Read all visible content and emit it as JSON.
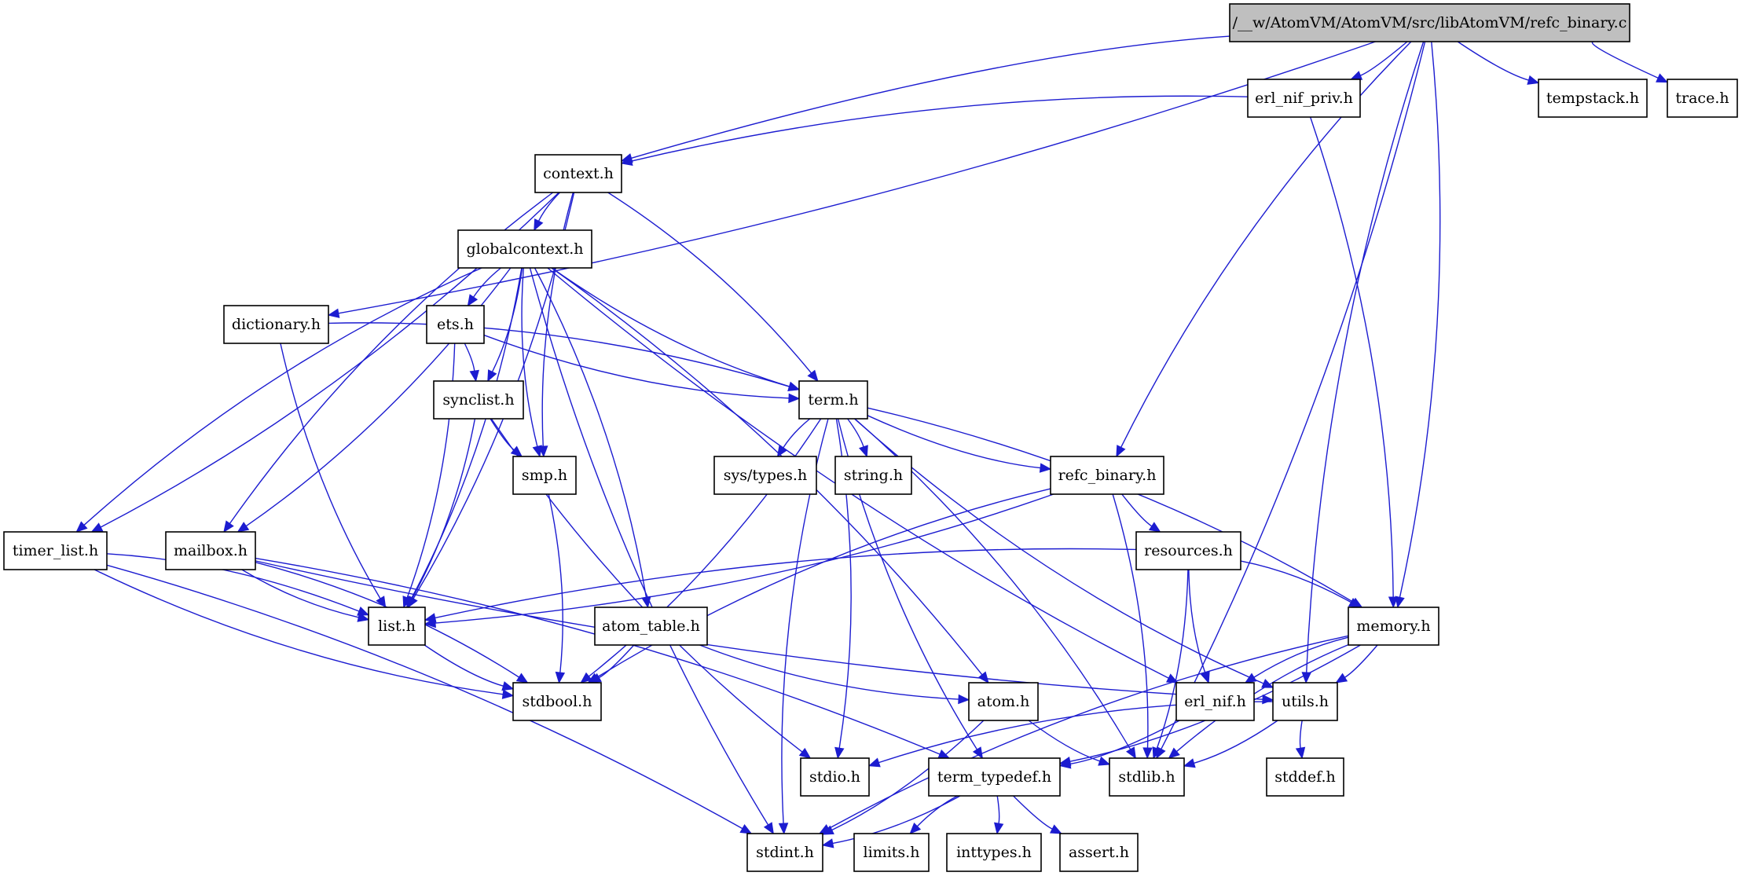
{
  "diagram": {
    "type": "include-dependency-graph",
    "root": "/__w/AtomVM/AtomVM/src/libAtomVM/refc_binary.c",
    "colors": {
      "edge": "#1c1cd0",
      "root_fill": "#bfbfbf",
      "node_fill": "#ffffff",
      "node_border": "#000000"
    },
    "nodes": [
      {
        "id": "refc_binary_c",
        "label": "/__w/AtomVM/AtomVM/src/libAtomVM/refc_binary.c",
        "root": true
      },
      {
        "id": "erl_nif_priv_h",
        "label": "erl_nif_priv.h"
      },
      {
        "id": "tempstack_h",
        "label": "tempstack.h"
      },
      {
        "id": "trace_h",
        "label": "trace.h"
      },
      {
        "id": "context_h",
        "label": "context.h"
      },
      {
        "id": "globalcontext_h",
        "label": "globalcontext.h"
      },
      {
        "id": "dictionary_h",
        "label": "dictionary.h"
      },
      {
        "id": "ets_h",
        "label": "ets.h"
      },
      {
        "id": "synclist_h",
        "label": "synclist.h"
      },
      {
        "id": "term_h",
        "label": "term.h"
      },
      {
        "id": "smp_h",
        "label": "smp.h"
      },
      {
        "id": "sys_types_h",
        "label": "sys/types.h"
      },
      {
        "id": "string_h",
        "label": "string.h"
      },
      {
        "id": "refc_binary_h",
        "label": "refc_binary.h"
      },
      {
        "id": "timer_list_h",
        "label": "timer_list.h"
      },
      {
        "id": "mailbox_h",
        "label": "mailbox.h"
      },
      {
        "id": "resources_h",
        "label": "resources.h"
      },
      {
        "id": "list_h",
        "label": "list.h"
      },
      {
        "id": "atom_table_h",
        "label": "atom_table.h"
      },
      {
        "id": "memory_h",
        "label": "memory.h"
      },
      {
        "id": "stdbool_h",
        "label": "stdbool.h"
      },
      {
        "id": "atom_h",
        "label": "atom.h"
      },
      {
        "id": "erl_nif_h",
        "label": "erl_nif.h"
      },
      {
        "id": "utils_h",
        "label": "utils.h"
      },
      {
        "id": "stdio_h",
        "label": "stdio.h"
      },
      {
        "id": "term_typedef_h",
        "label": "term_typedef.h"
      },
      {
        "id": "stdlib_h",
        "label": "stdlib.h"
      },
      {
        "id": "stddef_h",
        "label": "stddef.h"
      },
      {
        "id": "stdint_h",
        "label": "stdint.h"
      },
      {
        "id": "limits_h",
        "label": "limits.h"
      },
      {
        "id": "inttypes_h",
        "label": "inttypes.h"
      },
      {
        "id": "assert_h",
        "label": "assert.h"
      }
    ],
    "edges": [
      [
        "refc_binary_c",
        "dictionary_h"
      ],
      [
        "refc_binary_c",
        "context_h"
      ],
      [
        "refc_binary_c",
        "erl_nif_priv_h"
      ],
      [
        "refc_binary_c",
        "refc_binary_h"
      ],
      [
        "refc_binary_c",
        "memory_h"
      ],
      [
        "refc_binary_c",
        "utils_h"
      ],
      [
        "refc_binary_c",
        "stdlib_h"
      ],
      [
        "refc_binary_c",
        "tempstack_h"
      ],
      [
        "refc_binary_c",
        "trace_h"
      ],
      [
        "erl_nif_priv_h",
        "context_h"
      ],
      [
        "erl_nif_priv_h",
        "memory_h"
      ],
      [
        "context_h",
        "globalcontext_h"
      ],
      [
        "context_h",
        "timer_list_h"
      ],
      [
        "context_h",
        "mailbox_h"
      ],
      [
        "context_h",
        "list_h"
      ],
      [
        "context_h",
        "smp_h"
      ],
      [
        "context_h",
        "term_h"
      ],
      [
        "globalcontext_h",
        "timer_list_h"
      ],
      [
        "globalcontext_h",
        "mailbox_h"
      ],
      [
        "globalcontext_h",
        "stdint_h"
      ],
      [
        "globalcontext_h",
        "list_h"
      ],
      [
        "globalcontext_h",
        "ets_h"
      ],
      [
        "globalcontext_h",
        "synclist_h"
      ],
      [
        "globalcontext_h",
        "smp_h"
      ],
      [
        "globalcontext_h",
        "atom_table_h"
      ],
      [
        "globalcontext_h",
        "term_h"
      ],
      [
        "globalcontext_h",
        "atom_h"
      ],
      [
        "globalcontext_h",
        "erl_nif_h"
      ],
      [
        "dictionary_h",
        "term_h"
      ],
      [
        "dictionary_h",
        "list_h"
      ],
      [
        "ets_h",
        "synclist_h"
      ],
      [
        "ets_h",
        "term_h"
      ],
      [
        "ets_h",
        "list_h"
      ],
      [
        "synclist_h",
        "smp_h"
      ],
      [
        "synclist_h",
        "list_h"
      ],
      [
        "synclist_h",
        "stdio_h"
      ],
      [
        "smp_h",
        "stdbool_h"
      ],
      [
        "term_h",
        "sys_types_h"
      ],
      [
        "term_h",
        "string_h"
      ],
      [
        "term_h",
        "refc_binary_h"
      ],
      [
        "term_h",
        "memory_h"
      ],
      [
        "term_h",
        "utils_h"
      ],
      [
        "term_h",
        "stdbool_h"
      ],
      [
        "term_h",
        "stdint_h"
      ],
      [
        "term_h",
        "stdio_h"
      ],
      [
        "term_h",
        "term_typedef_h"
      ],
      [
        "term_h",
        "stdlib_h"
      ],
      [
        "refc_binary_h",
        "resources_h"
      ],
      [
        "refc_binary_h",
        "list_h"
      ],
      [
        "refc_binary_h",
        "stdbool_h"
      ],
      [
        "refc_binary_h",
        "stdlib_h"
      ],
      [
        "resources_h",
        "list_h"
      ],
      [
        "resources_h",
        "memory_h"
      ],
      [
        "resources_h",
        "erl_nif_h"
      ],
      [
        "resources_h",
        "stdlib_h"
      ],
      [
        "memory_h",
        "erl_nif_h"
      ],
      [
        "memory_h",
        "utils_h"
      ],
      [
        "memory_h",
        "stdlib_h"
      ],
      [
        "memory_h",
        "term_typedef_h"
      ],
      [
        "memory_h",
        "stdint_h"
      ],
      [
        "timer_list_h",
        "list_h"
      ],
      [
        "timer_list_h",
        "stdbool_h"
      ],
      [
        "timer_list_h",
        "stdint_h"
      ],
      [
        "mailbox_h",
        "list_h"
      ],
      [
        "mailbox_h",
        "stdbool_h"
      ],
      [
        "mailbox_h",
        "utils_h"
      ],
      [
        "mailbox_h",
        "term_typedef_h"
      ],
      [
        "list_h",
        "stdbool_h"
      ],
      [
        "atom_table_h",
        "stdbool_h"
      ],
      [
        "atom_table_h",
        "atom_h"
      ],
      [
        "atom_h",
        "stdint_h"
      ],
      [
        "atom_h",
        "stdlib_h"
      ],
      [
        "erl_nif_h",
        "term_typedef_h"
      ],
      [
        "utils_h",
        "stdio_h"
      ],
      [
        "utils_h",
        "stdlib_h"
      ],
      [
        "utils_h",
        "stddef_h"
      ],
      [
        "term_typedef_h",
        "stdint_h"
      ],
      [
        "term_typedef_h",
        "limits_h"
      ],
      [
        "term_typedef_h",
        "inttypes_h"
      ],
      [
        "term_typedef_h",
        "assert_h"
      ]
    ]
  }
}
